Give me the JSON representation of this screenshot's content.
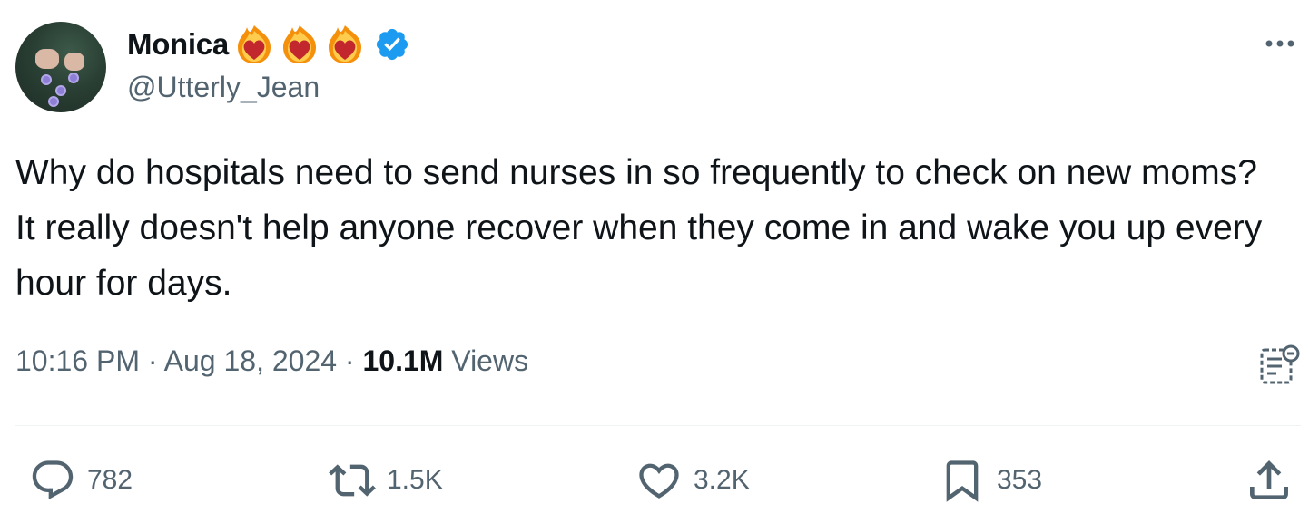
{
  "author": {
    "display_name": "Monica",
    "handle": "@Utterly_Jean",
    "badges": [
      "heart-on-fire-emoji",
      "heart-on-fire-emoji",
      "heart-on-fire-emoji",
      "verified-badge-icon"
    ],
    "verified_color": "#1d9bf0"
  },
  "tweet": {
    "text": "Why do hospitals need to send nurses in so frequently to check on new moms? It really doesn't help anyone recover when they come in and wake you up every hour for days.",
    "time": "10:16 PM",
    "separator": "·",
    "date": "Aug 18, 2024",
    "views_count": "10.1M",
    "views_label": "Views"
  },
  "actions": {
    "replies": "782",
    "reposts": "1.5K",
    "likes": "3.2K",
    "bookmarks": "353"
  },
  "colors": {
    "text": "#0f1419",
    "secondary": "#536471",
    "divider": "#eff3f4"
  }
}
